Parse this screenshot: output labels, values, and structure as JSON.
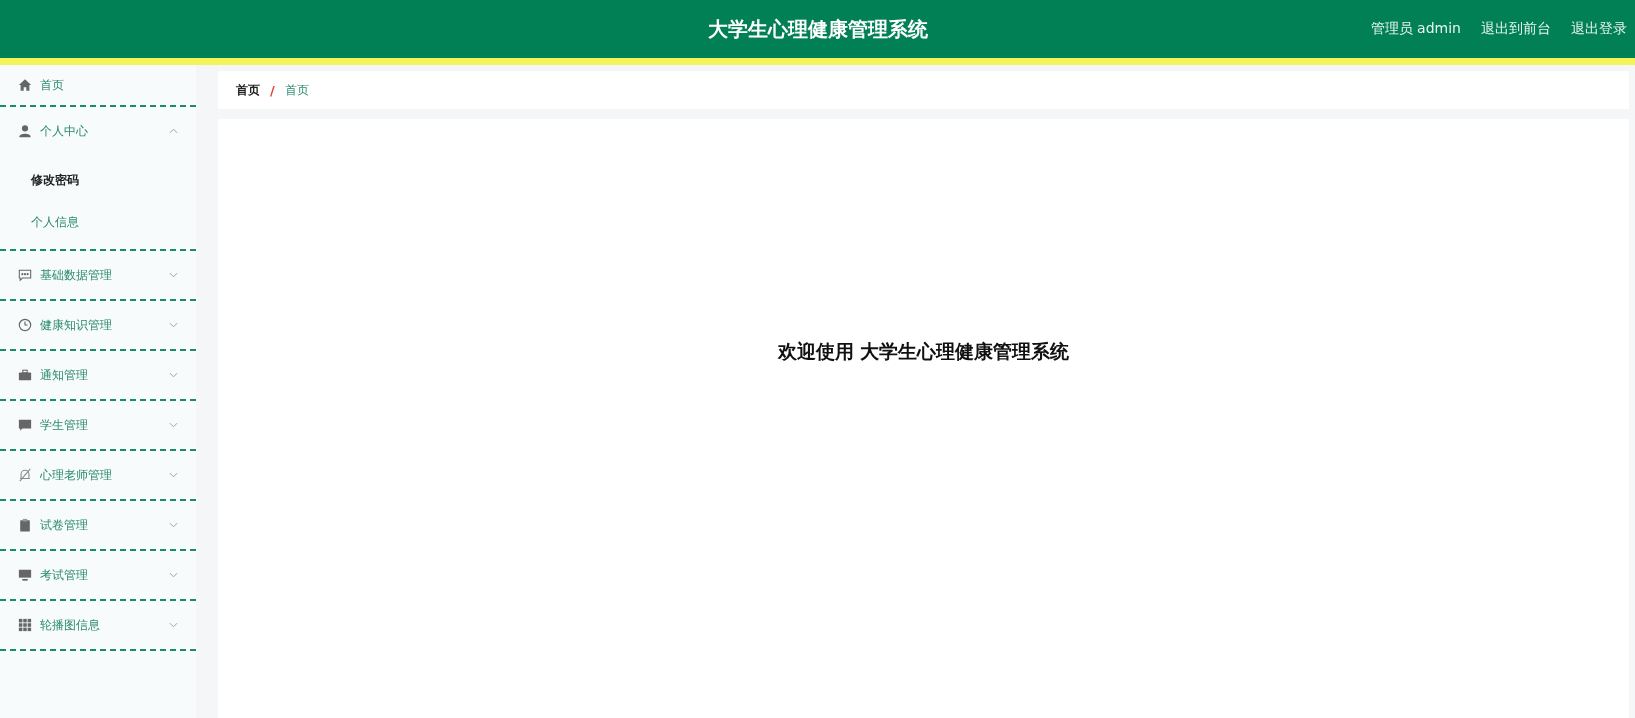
{
  "header": {
    "title": "大学生心理健康管理系统",
    "user": "管理员 admin",
    "links": [
      "退出到前台",
      "退出登录"
    ]
  },
  "sidebar": {
    "items": [
      {
        "label": "首页",
        "expandable": false
      },
      {
        "label": "个人中心",
        "expandable": true,
        "expanded": true,
        "children": [
          {
            "label": "修改密码",
            "selected": true
          },
          {
            "label": "个人信息",
            "selected": false
          }
        ]
      },
      {
        "label": "基础数据管理",
        "expandable": true,
        "expanded": false
      },
      {
        "label": "健康知识管理",
        "expandable": true,
        "expanded": false
      },
      {
        "label": "通知管理",
        "expandable": true,
        "expanded": false
      },
      {
        "label": "学生管理",
        "expandable": true,
        "expanded": false
      },
      {
        "label": "心理老师管理",
        "expandable": true,
        "expanded": false
      },
      {
        "label": "试卷管理",
        "expandable": true,
        "expanded": false
      },
      {
        "label": "考试管理",
        "expandable": true,
        "expanded": false
      },
      {
        "label": "轮播图信息",
        "expandable": true,
        "expanded": false
      }
    ]
  },
  "breadcrumb": {
    "items": [
      "首页",
      "首页"
    ],
    "separator": "/"
  },
  "welcome": "欢迎使用 大学生心理健康管理系统"
}
